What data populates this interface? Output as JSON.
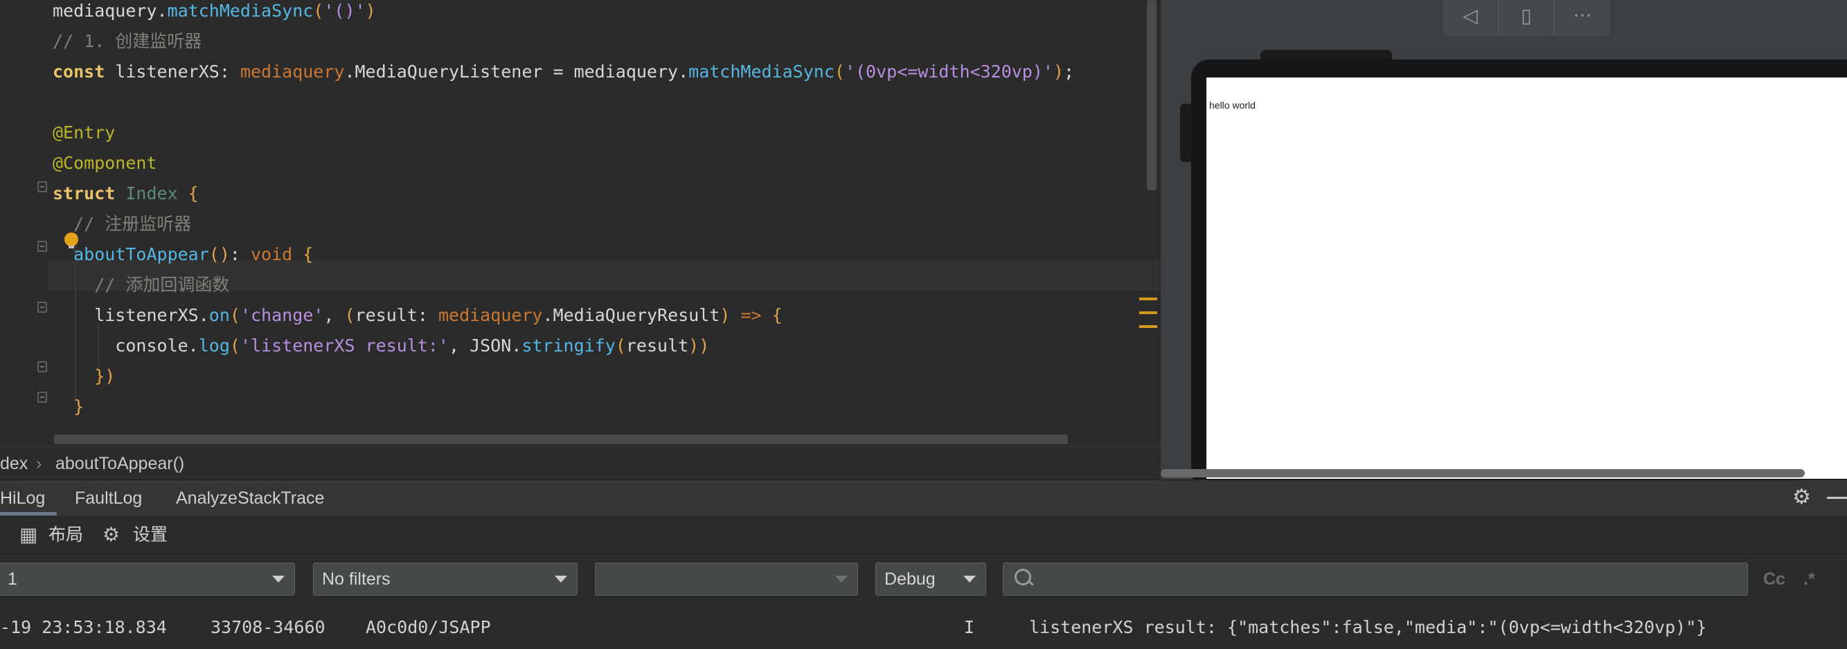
{
  "editor": {
    "lines": [
      {
        "parts": [
          [
            "txt",
            "mediaquery."
          ],
          [
            "fn",
            "matchMediaSync"
          ],
          [
            "par",
            "("
          ],
          [
            "str",
            "'()'"
          ],
          [
            "par",
            ")"
          ]
        ]
      },
      {
        "parts": [
          [
            "cm",
            "// 1. 创建监听器"
          ]
        ]
      },
      {
        "parts": [
          [
            "kw",
            "const "
          ],
          [
            "txt",
            "listenerXS: "
          ],
          [
            "ns",
            "mediaquery"
          ],
          [
            "txt",
            ".MediaQueryListener = mediaquery."
          ],
          [
            "fn",
            "matchMediaSync"
          ],
          [
            "par",
            "("
          ],
          [
            "str",
            "'(0vp<=width<320vp)'"
          ],
          [
            "par",
            ")"
          ],
          [
            "txt",
            ";"
          ]
        ]
      },
      {
        "parts": []
      },
      {
        "parts": [
          [
            "ann",
            "@Entry"
          ]
        ]
      },
      {
        "parts": [
          [
            "ann",
            "@Component"
          ]
        ]
      },
      {
        "parts": [
          [
            "kw",
            "struct "
          ],
          [
            "type",
            "Index "
          ],
          [
            "par",
            "{"
          ]
        ]
      },
      {
        "parts": [
          [
            "cm",
            "  // 注册监听器"
          ]
        ]
      },
      {
        "parts": [
          [
            "txt",
            "  "
          ],
          [
            "fn",
            "aboutToAppear"
          ],
          [
            "par",
            "()"
          ],
          [
            "txt",
            ": "
          ],
          [
            "kw2",
            "void "
          ],
          [
            "par",
            "{"
          ]
        ]
      },
      {
        "parts": [
          [
            "cm",
            "    // 添加回调函数"
          ]
        ]
      },
      {
        "parts": [
          [
            "txt",
            "    listenerXS."
          ],
          [
            "fn",
            "on"
          ],
          [
            "par",
            "("
          ],
          [
            "str",
            "'change'"
          ],
          [
            "txt",
            ", "
          ],
          [
            "par",
            "("
          ],
          [
            "txt",
            "result: "
          ],
          [
            "ns",
            "mediaquery"
          ],
          [
            "txt",
            ".MediaQueryResult"
          ],
          [
            "par",
            ")"
          ],
          [
            "txt",
            " "
          ],
          [
            "kw2",
            "=>"
          ],
          [
            "txt",
            " "
          ],
          [
            "par",
            "{"
          ]
        ]
      },
      {
        "parts": [
          [
            "txt",
            "      console."
          ],
          [
            "fn",
            "log"
          ],
          [
            "par",
            "("
          ],
          [
            "str",
            "'listenerXS result:'"
          ],
          [
            "txt",
            ", JSON."
          ],
          [
            "fn",
            "stringify"
          ],
          [
            "par",
            "("
          ],
          [
            "txt",
            "result"
          ],
          [
            "par",
            "))"
          ]
        ]
      },
      {
        "parts": [
          [
            "par",
            "    })"
          ]
        ]
      },
      {
        "parts": [
          [
            "par",
            "  }"
          ]
        ]
      }
    ]
  },
  "breadcrumb": {
    "file": "dex",
    "separator": "›",
    "method": "aboutToAppear()"
  },
  "previewer": {
    "toolbar": {
      "back_icon": "◁",
      "rotate_icon": "▯",
      "more_icon": "···"
    },
    "screen_text": "hello world"
  },
  "panel": {
    "tabs": [
      "HiLog",
      "FaultLog",
      "AnalyzeStackTrace"
    ],
    "layout_label": "布局",
    "settings_label": "设置",
    "device_value": "1",
    "filter_value": "No filters",
    "process_value": "",
    "level_value": "Debug",
    "search_placeholder": "",
    "case_toggle": "Cc",
    "regex_toggle": ".*",
    "log": {
      "time": "-19 23:53:18.834",
      "pid": "33708-34660",
      "tag": "A0c0d0/JSAPP",
      "level": "I",
      "message": "listenerXS result: {\"matches\":false,\"media\":\"(0vp<=width<320vp)\"}"
    }
  }
}
